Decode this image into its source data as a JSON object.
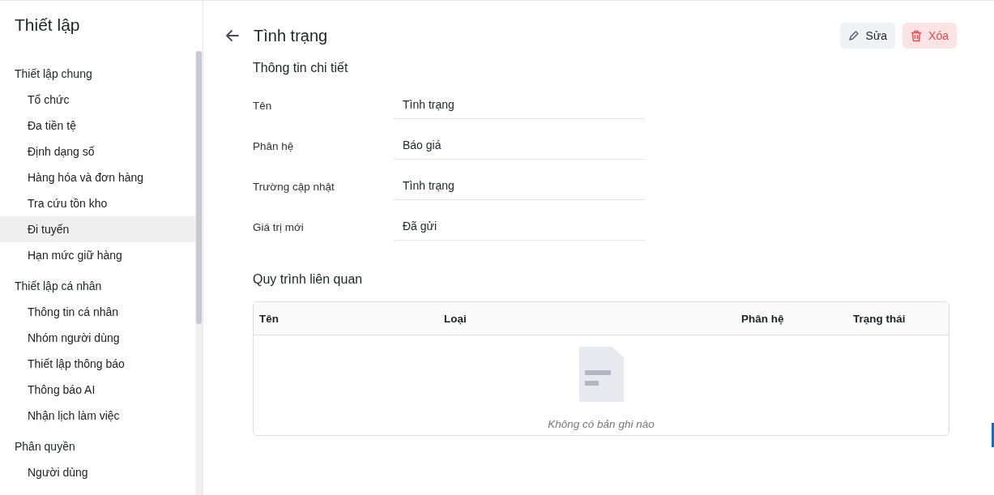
{
  "sidebar": {
    "title": "Thiết lập",
    "groups": [
      {
        "heading": "Thiết lập chung",
        "items": [
          {
            "label": "Tổ chức",
            "selected": false
          },
          {
            "label": "Đa tiền tệ",
            "selected": false
          },
          {
            "label": "Định dạng số",
            "selected": false
          },
          {
            "label": "Hàng hóa và đơn hàng",
            "selected": false
          },
          {
            "label": "Tra cứu tồn kho",
            "selected": false
          },
          {
            "label": "Đi tuyến",
            "selected": true
          },
          {
            "label": "Hạn mức giữ hàng",
            "selected": false
          }
        ]
      },
      {
        "heading": "Thiết lập cá nhân",
        "items": [
          {
            "label": "Thông tin cá nhân",
            "selected": false
          },
          {
            "label": "Nhóm người dùng",
            "selected": false
          },
          {
            "label": "Thiết lập thông báo",
            "selected": false
          },
          {
            "label": "Thông báo AI",
            "selected": false
          },
          {
            "label": "Nhận lịch làm việc",
            "selected": false
          }
        ]
      },
      {
        "heading": "Phân quyền",
        "items": [
          {
            "label": "Người dùng",
            "selected": false
          }
        ]
      }
    ]
  },
  "page": {
    "title": "Tình trạng",
    "actions": [
      {
        "label": "Sửa",
        "kind": "edit"
      },
      {
        "label": "Xóa",
        "kind": "delete"
      }
    ]
  },
  "details": {
    "title": "Thông tin chi tiết",
    "fields": [
      {
        "label": "Tên",
        "value": "Tình trạng"
      },
      {
        "label": "Phân hệ",
        "value": "Báo giá"
      },
      {
        "label": "Trường cập nhật",
        "value": "Tình trạng"
      },
      {
        "label": "Giá trị mới",
        "value": "Đã gửi"
      }
    ]
  },
  "related": {
    "title": "Quy trình liên quan",
    "columns": [
      "Tên",
      "Loại",
      "Phân hệ",
      "Trạng thái"
    ],
    "empty_text": "Không có bản ghi nào"
  }
}
